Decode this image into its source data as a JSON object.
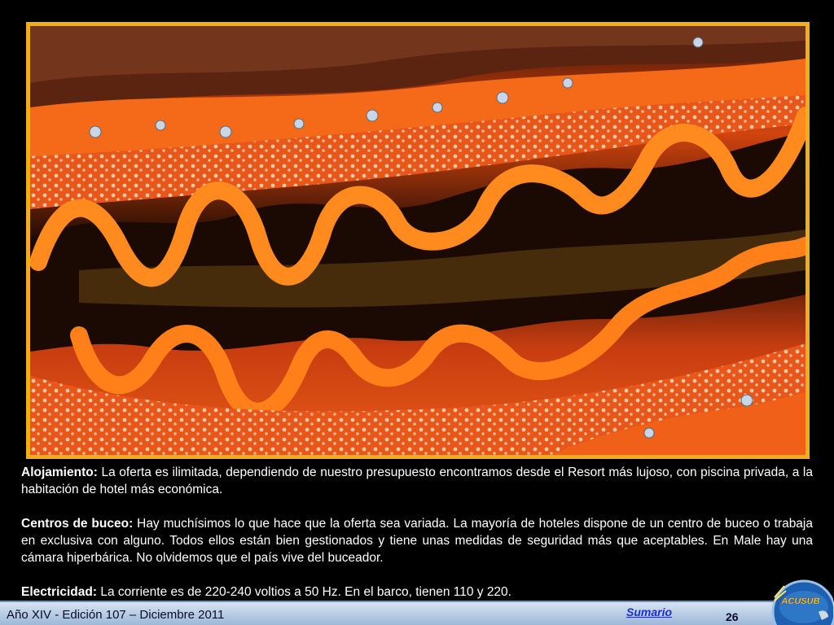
{
  "photo": {
    "subject": "scallop-mantle-photo"
  },
  "paragraphs": [
    {
      "label": "Alojamiento:",
      "text": " La oferta es ilimitada, dependiendo de nuestro presupuesto encontramos desde el Resort  más lujoso, con piscina privada, a la habitación de hotel más económica."
    },
    {
      "label": "Centros de buceo:",
      "text": " Hay muchísimos lo que hace que la oferta sea variada. La mayoría de hoteles dispone de un centro de buceo o trabaja en exclusiva con alguno. Todos ellos  están bien gestionados y tiene unas medidas de seguridad más que aceptables. En Male hay una cámara hiperbárica. No olvidemos que el país vive del buceador."
    },
    {
      "label": "Electricidad:",
      "text": " La corriente es de 220-240 voltios a 50 Hz. En el barco, tienen 110 y 220."
    }
  ],
  "footer": {
    "edition": "Año XIV - Edición 107 – Diciembre 2011",
    "sumario": "Sumario",
    "page": "26"
  },
  "logo": {
    "text": "ACUSUB"
  },
  "colors": {
    "frame": "#f2ae1a",
    "footer": "#b8cde6",
    "link": "#1a2fd0",
    "mantle": "#ff6a10"
  }
}
